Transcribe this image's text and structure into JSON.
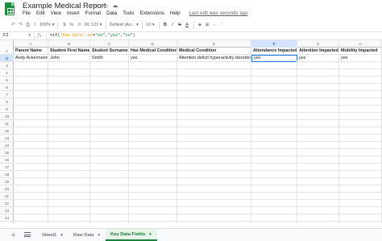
{
  "window": {
    "doc_title": "Example Medical Report",
    "title_icons": [
      "star-icon",
      "move-to-folder-icon",
      "cloud-status-icon"
    ]
  },
  "menu": {
    "items": [
      "File",
      "Edit",
      "View",
      "Insert",
      "Format",
      "Data",
      "Tools",
      "Extensions",
      "Help"
    ],
    "last_edit": "Last edit was seconds ago"
  },
  "toolbar": {
    "zoom": "100%",
    "currency": "$",
    "percent": "%",
    "decrease_decimal": ".0",
    "increase_decimal": ".00",
    "more_formats": "123",
    "font": "Default (Ari...",
    "font_size": "10",
    "bold": "B",
    "italic": "I",
    "strikethrough": "S",
    "text_color": "A"
  },
  "formula_bar": {
    "cell_ref": "F2",
    "fx": "fx",
    "formula_prefix": "=if(",
    "formula_ref": "'Raw Data'!N2",
    "formula_mid": "=",
    "formula_str1": "\"on\"",
    "formula_sep": ",",
    "formula_str2": "\"yes\"",
    "formula_sep2": ",",
    "formula_str3": "\"no\"",
    "formula_end": ")"
  },
  "grid": {
    "columns": [
      "A",
      "B",
      "C",
      "D",
      "E",
      "F",
      "G",
      "H"
    ],
    "selected_column": "F",
    "selected_row": "2",
    "row_numbers": [
      "1",
      "2",
      "3",
      "4",
      "5",
      "6",
      "7",
      "8",
      "9",
      "10",
      "11",
      "12",
      "13",
      "14",
      "15",
      "16",
      "17",
      "18",
      "19",
      "20",
      "21",
      "22",
      "23",
      "24"
    ],
    "header_row": [
      "Parent Name",
      "Student First Name",
      "Student Surname",
      "Has Medical Condition",
      "Medical Condition",
      "Attendance Impacted",
      "Attention Impacted",
      "Mobility Impacted"
    ],
    "data_rows": [
      [
        "Andy Ackermann",
        "John",
        "Smith",
        "yes",
        "Attention deficit hyperactivity disorder",
        "yes",
        "yes",
        "yes"
      ]
    ]
  },
  "sheets": {
    "add_icon": "+",
    "tabs": [
      {
        "label": "Sheet1",
        "active": false
      },
      {
        "label": "Raw Data",
        "active": false
      },
      {
        "label": "Key Data Fields",
        "active": true
      }
    ]
  },
  "colors": {
    "accent": "#1a73e8",
    "sheets_green": "#188038",
    "selection_header": "#d3e3fd"
  }
}
